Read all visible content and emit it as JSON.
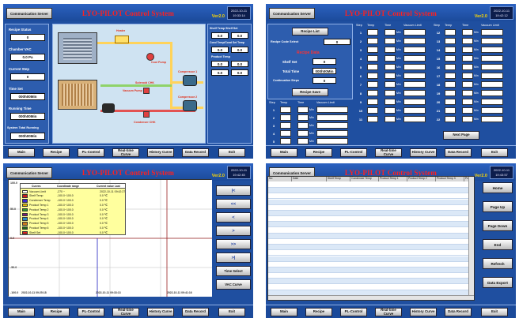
{
  "common": {
    "comm_button": "Communication Server",
    "title": "LYO-PILOT Control System",
    "version": "Ver2.0",
    "footer": [
      "Main",
      "Recipe",
      "PL-Control",
      "Real-time Curve",
      "History Curve",
      "Data Record",
      "Exit"
    ]
  },
  "p1": {
    "clock_date": "2022-10-11",
    "clock_time": "19:33:14",
    "left": [
      {
        "label": "Recipe Status",
        "value": "0"
      },
      {
        "label": "Chamber VAC",
        "value": "0.0 Pa"
      },
      {
        "label": "Current Step",
        "value": "0"
      },
      {
        "label": "Time Set",
        "value": "000h00Min"
      },
      {
        "label": "Running Time",
        "value": "000h00Min"
      },
      {
        "label": "System Total Running",
        "value": "000h00Min"
      }
    ],
    "diagram_labels": {
      "heater": "Heater",
      "cool_pump": "Cool Pump",
      "vacuum_pump": "Vacuum Pump",
      "solenoid": "Solenoid CHK",
      "condenser_chk": "Condenser CHK",
      "compressor1": "Compressor 1",
      "compressor2": "Compressor 2"
    },
    "right": {
      "header": "Shelf Temp   Shelf Set",
      "row1": [
        "0.0",
        "0.0"
      ],
      "cond_header": "Cond Temp/Cond Set Temp",
      "row2": [
        "0.0",
        "0.0"
      ],
      "prod_header": "Product Temp",
      "row3": [
        "0.0",
        "0.0"
      ],
      "row4": [
        "0.0",
        "0.0"
      ]
    }
  },
  "p2": {
    "clock_date": "2022-10-11",
    "clock_time": "19:42:12",
    "recipe_list": "Recipe List",
    "recipe_code_label": "Recipe Code Select",
    "recipe_code_value": "0",
    "recipe_title": "Recipe Data",
    "fields": [
      {
        "label": "Shelf Set",
        "value": "0"
      },
      {
        "label": "Total Time",
        "value": "000h00Min"
      },
      {
        "label": "Continuation Steps",
        "value": "0"
      }
    ],
    "recipe_save": "Recipe Save",
    "col_headers": [
      "Step",
      "Temp",
      "Time",
      "Vacuum Limit"
    ],
    "unit": "Min",
    "next_page": "Next Page"
  },
  "p3": {
    "clock_date": "2022-10-11",
    "clock_time": "19:42:45",
    "legend_headers": [
      "Curves",
      "Coordinate range",
      "Current value Last"
    ],
    "legend_time": "2022-10-11 09:42:27",
    "legend": [
      {
        "name": "Vacuum Limit",
        "range": "-270 ~ ",
        "value": "",
        "color": "#ffffff"
      },
      {
        "name": "Shelf Temp",
        "range": "-100.0~100.0",
        "value": "0.0 ℃",
        "color": "#c81e1e"
      },
      {
        "name": "Condenser Temp",
        "range": "-100.0~100.0",
        "value": "0.0 ℃",
        "color": "#3a2ad0"
      },
      {
        "name": "Product Temp 1",
        "range": "-100.0~100.0",
        "value": "0.0 ℃",
        "color": "#e0b800"
      },
      {
        "name": "Product Temp 2",
        "range": "-100.0~100.0",
        "value": "0.0 ℃",
        "color": "#2e9a2e"
      },
      {
        "name": "Product Temp 3",
        "range": "-100.0~100.0",
        "value": "0.0 ℃",
        "color": "#7a1e7a"
      },
      {
        "name": "Product Temp 4",
        "range": "-100.0~100.0",
        "value": "0.0 ℃",
        "color": "#2a8ac8"
      },
      {
        "name": "Product Temp 5",
        "range": "-100.0~100.0",
        "value": "0.0 ℃",
        "color": "#c87a1e"
      },
      {
        "name": "Product Temp 6",
        "range": "-100.0~100.0",
        "value": "0.0 ℃",
        "color": "#1e6a1e"
      },
      {
        "name": "Shelf Set",
        "range": "-100.0~100.0",
        "value": "0.0 ℃",
        "color": "#e02020"
      }
    ],
    "y_ticks": [
      "100.0",
      "50.0",
      "0.0",
      "-50.0",
      "-100.0"
    ],
    "x_start": "2022-10-11 09:25:18",
    "x_mid": "2022-10-11 09:33:13",
    "x_end": "2022-10-11 09:41:16",
    "side_buttons": [
      "|<",
      "<<",
      "<",
      ">",
      ">>",
      ">|",
      "Time Select",
      "VAC Curve"
    ]
  },
  "p4": {
    "clock_date": "2022-10-11",
    "clock_time": "19:43:57",
    "columns": [
      "No",
      "Date",
      "Shelf Temp",
      "Condenser Temp",
      "Product Temp 1",
      "Product Temp 2",
      "Product Temp 3",
      "Product T"
    ],
    "buttons": [
      "Home",
      "Page Up",
      "Page Down",
      "End",
      "Refresh",
      "Data Export"
    ]
  }
}
